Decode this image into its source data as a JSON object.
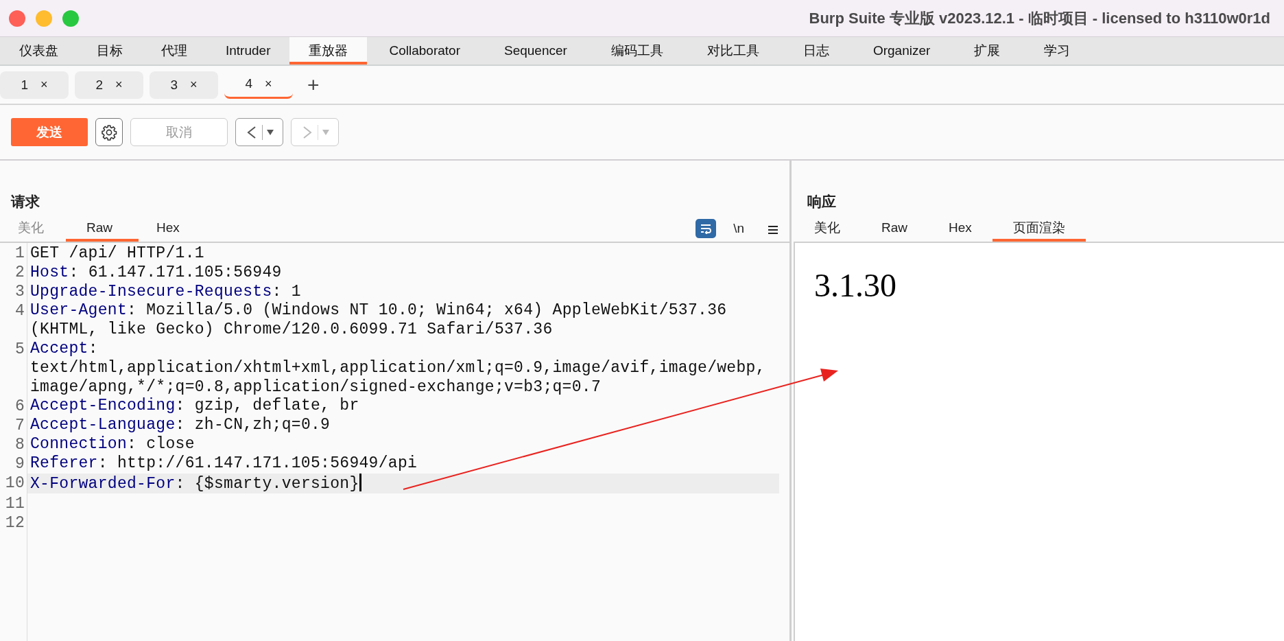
{
  "window": {
    "title": "Burp Suite 专业版  v2023.12.1 - 临时项目 - licensed to h3110w0r1d"
  },
  "main_tabs": [
    {
      "label": "仪表盘",
      "selected": false
    },
    {
      "label": "目标",
      "selected": false
    },
    {
      "label": "代理",
      "selected": false
    },
    {
      "label": "Intruder",
      "selected": false
    },
    {
      "label": "重放器",
      "selected": true
    },
    {
      "label": "Collaborator",
      "selected": false
    },
    {
      "label": "Sequencer",
      "selected": false
    },
    {
      "label": "编码工具",
      "selected": false
    },
    {
      "label": "对比工具",
      "selected": false
    },
    {
      "label": "日志",
      "selected": false
    },
    {
      "label": "Organizer",
      "selected": false
    },
    {
      "label": "扩展",
      "selected": false
    },
    {
      "label": "学习",
      "selected": false
    }
  ],
  "repeater_tabs": [
    {
      "label": "1",
      "close": "×",
      "selected": false
    },
    {
      "label": "2",
      "close": "×",
      "selected": false
    },
    {
      "label": "3",
      "close": "×",
      "selected": false
    },
    {
      "label": "4",
      "close": "×",
      "selected": true
    }
  ],
  "add_tab": "+",
  "toolbar": {
    "send": "发送",
    "cancel": {
      "label": "取消",
      "disabled": true
    },
    "back": {
      "disabled": false
    },
    "forward": {
      "disabled": true
    }
  },
  "request": {
    "title": "请求",
    "tabs": [
      {
        "label": "美化",
        "selected": false,
        "disabled": true
      },
      {
        "label": "Raw",
        "selected": true,
        "disabled": false
      },
      {
        "label": "Hex",
        "selected": false,
        "disabled": false
      }
    ],
    "wrap_on": true,
    "newline_label": "\\n",
    "lines": [
      {
        "number": "1",
        "kind": "request_line",
        "text": "GET /api/ HTTP/1.1",
        "current": false
      },
      {
        "number": "2",
        "kind": "header",
        "name": "Host",
        "value": ": 61.147.171.105:56949",
        "current": false
      },
      {
        "number": "3",
        "kind": "header",
        "name": "Upgrade-Insecure-Requests",
        "value": ": 1",
        "current": false
      },
      {
        "number": "4",
        "kind": "header",
        "name": "User-Agent",
        "value": ": Mozilla/5.0 (Windows NT 10.0; Win64; x64) AppleWebKit/537.36 (KHTML, like Gecko) Chrome/120.0.6099.71 Safari/537.36",
        "current": false
      },
      {
        "number": "5",
        "kind": "header",
        "name": "Accept",
        "value": ": text/html,application/xhtml+xml,application/xml;q=0.9,image/avif,image/webp,image/apng,*/*;q=0.8,application/signed-exchange;v=b3;q=0.7",
        "current": false
      },
      {
        "number": "6",
        "kind": "header",
        "name": "Accept-Encoding",
        "value": ": gzip, deflate, br",
        "current": false
      },
      {
        "number": "7",
        "kind": "header",
        "name": "Accept-Language",
        "value": ": zh-CN,zh;q=0.9",
        "current": false
      },
      {
        "number": "8",
        "kind": "header",
        "name": "Connection",
        "value": ": close",
        "current": false
      },
      {
        "number": "9",
        "kind": "header",
        "name": "Referer",
        "value": ": http://61.147.171.105:56949/api",
        "current": false
      },
      {
        "number": "10",
        "kind": "header",
        "name": "X-Forwarded-For",
        "value": ": {$smarty.version}",
        "current": true
      },
      {
        "number": "11",
        "kind": "blank",
        "current": false
      },
      {
        "number": "12",
        "kind": "blank",
        "current": false
      }
    ]
  },
  "response": {
    "title": "响应",
    "tabs": [
      {
        "label": "美化",
        "selected": false,
        "disabled": false
      },
      {
        "label": "Raw",
        "selected": false,
        "disabled": false
      },
      {
        "label": "Hex",
        "selected": false,
        "disabled": false
      },
      {
        "label": "页面渲染",
        "selected": true,
        "disabled": false
      }
    ],
    "rendered_text": "3.1.30"
  }
}
